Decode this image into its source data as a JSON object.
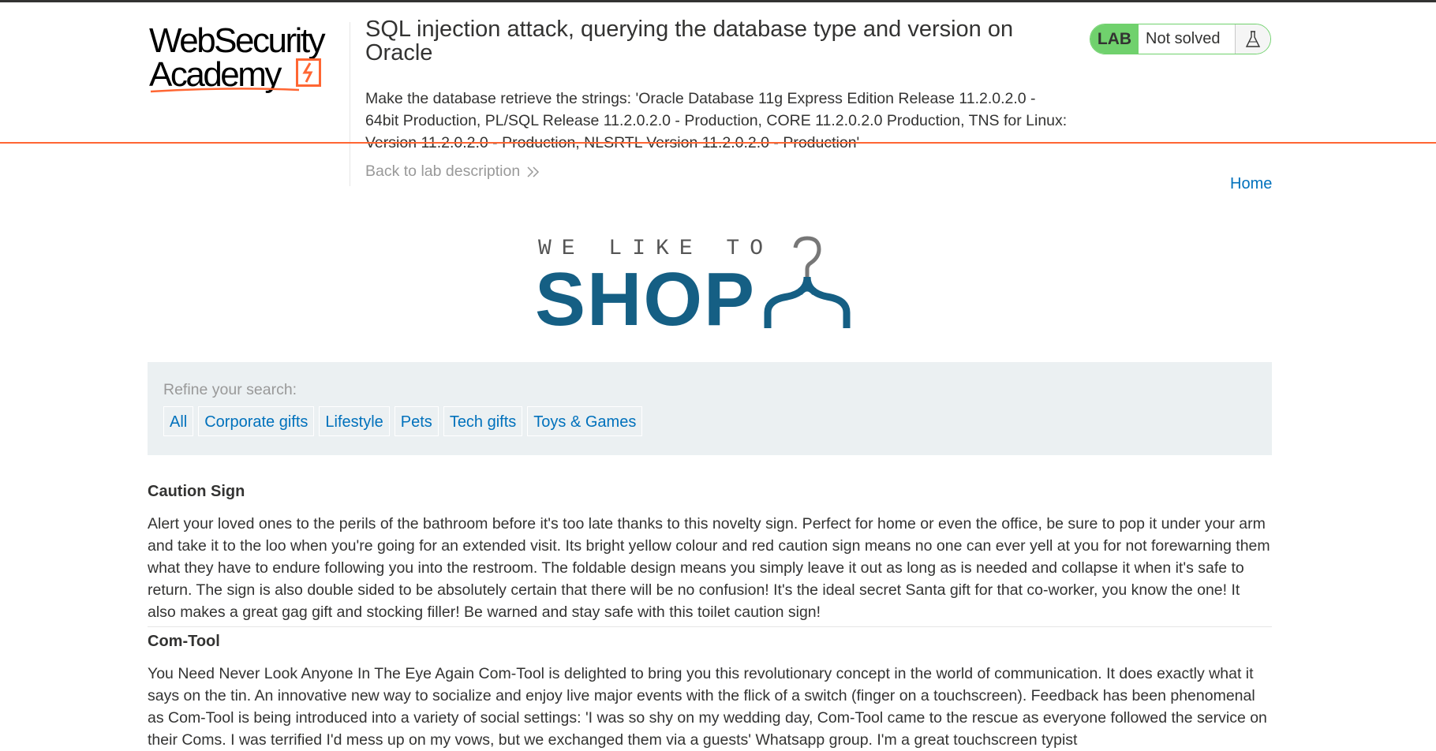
{
  "header": {
    "logo_line1": "WebSecurity",
    "logo_line2": "Academy",
    "title": "SQL injection attack, querying the database type and version on Oracle",
    "description": "Make the database retrieve the strings: 'Oracle Database 11g Express Edition Release 11.2.0.2.0 - 64bit Production, PL/SQL Release 11.2.0.2.0 - Production, CORE 11.2.0.2.0 Production, TNS for Linux: Version 11.2.0.2.0 - Production, NLSRTL Version 11.2.0.2.0 - Production'",
    "back_link": "Back to lab description",
    "lab_badge": "LAB",
    "status": "Not solved",
    "status_icon": "flask-icon"
  },
  "nav": {
    "home": "Home"
  },
  "shop_logo": {
    "tagline": "WE LIKE TO",
    "word": "SHOP",
    "icon": "hanger-icon"
  },
  "filters": {
    "label": "Refine your search:",
    "categories": [
      "All",
      "Corporate gifts",
      "Lifestyle",
      "Pets",
      "Tech gifts",
      "Toys & Games"
    ]
  },
  "products": [
    {
      "name": "Caution Sign",
      "description": "Alert your loved ones to the perils of the bathroom before it's too late thanks to this novelty sign. Perfect for home or even the office, be sure to pop it under your arm and take it to the loo when you're going for an extended visit. Its bright yellow colour and red caution sign means no one can ever yell at you for not forewarning them what they have to endure following you into the restroom. The foldable design means you simply leave it out as long as is needed and collapse it when it's safe to return. The sign is also double sided to be absolutely certain that there will be no confusion! It's the ideal secret Santa gift for that co-worker, you know the one! It also makes a great gag gift and stocking filler! Be warned and stay safe with this toilet caution sign!"
    },
    {
      "name": "Com-Tool",
      "description": "You Need Never Look Anyone In The Eye Again Com-Tool is delighted to bring you this revolutionary concept in the world of communication. It does exactly what it says on the tin. An innovative new way to socialize and enjoy live major events with the flick of a switch (finger on a touchscreen). Feedback has been phenomenal as Com-Tool is being introduced into a variety of social settings: 'I was so shy on my wedding day, Com-Tool came to the rescue as everyone followed the service on their Coms. I was terrified I'd mess up on my vows, but we exchanged them via a guests' Whatsapp group. I'm a great touchscreen typist"
    }
  ],
  "colors": {
    "accent_orange": "#ff6633",
    "lab_green": "#70d16d",
    "link_blue": "#0071bc",
    "shop_blue": "#155f84",
    "filter_bg": "#ebf0f2"
  }
}
